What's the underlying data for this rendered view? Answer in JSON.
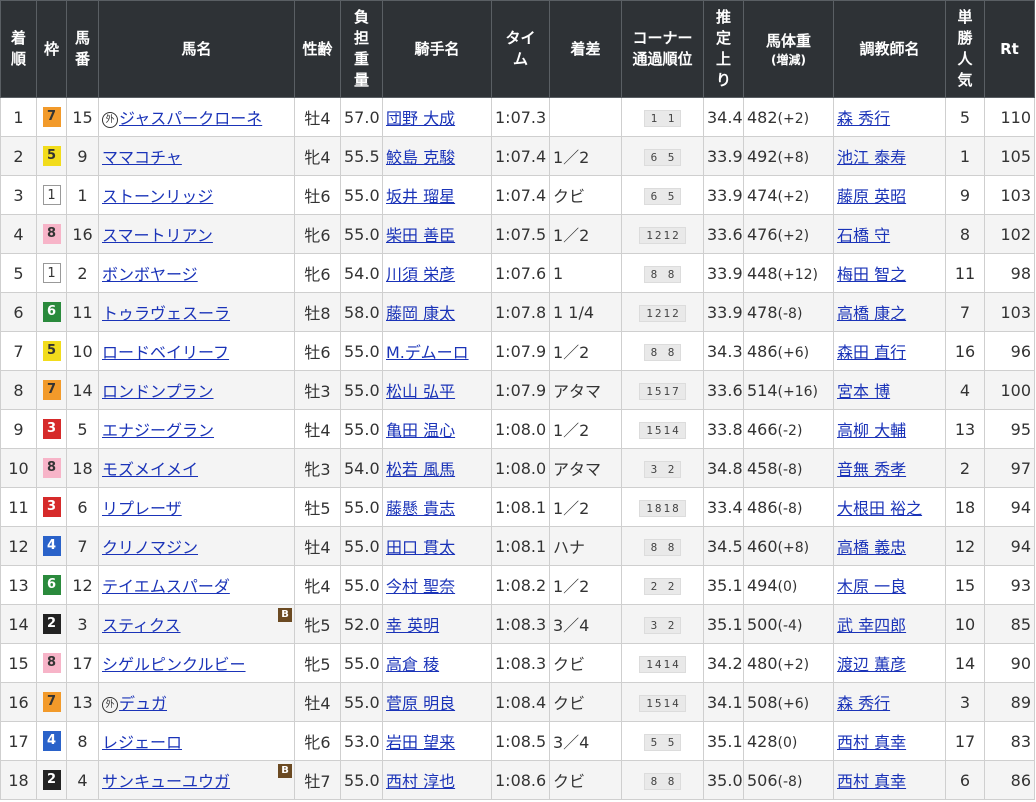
{
  "header": {
    "rank": [
      "着",
      "順"
    ],
    "waku": "枠",
    "num": [
      "馬",
      "番"
    ],
    "name": "馬名",
    "sex_age": "性齢",
    "weight": [
      "負",
      "担",
      "重",
      "量"
    ],
    "jockey": "騎手名",
    "time": [
      "タイ",
      "ム"
    ],
    "margin": "着差",
    "corner": [
      "コーナー",
      "通過順位"
    ],
    "last3f": [
      "推",
      "定",
      "上",
      "り"
    ],
    "body": "馬体重",
    "body_sub": "(増減)",
    "trainer": "調教師名",
    "popularity": [
      "単",
      "勝",
      "人",
      "気"
    ],
    "rt": "Rt"
  },
  "blinker_label": "B",
  "gaikoku_label": "外",
  "rows": [
    {
      "rank": "1",
      "waku": "7",
      "num": "15",
      "gaikoku": true,
      "name": "ジャスパークローネ",
      "blinker": false,
      "sex_age": "牡4",
      "weight": "57.0",
      "jockey": "団野 大成",
      "time": "1:07.3",
      "margin": "",
      "corner": "1 1",
      "last3f": "34.4",
      "body": "482",
      "body_chg": "(+2)",
      "trainer": "森 秀行",
      "pop": "5",
      "rt": "110"
    },
    {
      "rank": "2",
      "waku": "5",
      "num": "9",
      "gaikoku": false,
      "name": "ママコチャ",
      "blinker": false,
      "sex_age": "牝4",
      "weight": "55.5",
      "jockey": "鮫島 克駿",
      "time": "1:07.4",
      "margin": "1／2",
      "corner": "6 5",
      "last3f": "33.9",
      "body": "492",
      "body_chg": "(+8)",
      "trainer": "池江 泰寿",
      "pop": "1",
      "rt": "105"
    },
    {
      "rank": "3",
      "waku": "1",
      "num": "1",
      "gaikoku": false,
      "name": "ストーンリッジ",
      "blinker": false,
      "sex_age": "牡6",
      "weight": "55.0",
      "jockey": "坂井 瑠星",
      "time": "1:07.4",
      "margin": "クビ",
      "corner": "6 5",
      "last3f": "33.9",
      "body": "474",
      "body_chg": "(+2)",
      "trainer": "藤原 英昭",
      "pop": "9",
      "rt": "103"
    },
    {
      "rank": "4",
      "waku": "8",
      "num": "16",
      "gaikoku": false,
      "name": "スマートリアン",
      "blinker": false,
      "sex_age": "牝6",
      "weight": "55.0",
      "jockey": "柴田 善臣",
      "time": "1:07.5",
      "margin": "1／2",
      "corner": "1212",
      "last3f": "33.6",
      "body": "476",
      "body_chg": "(+2)",
      "trainer": "石橋 守",
      "pop": "8",
      "rt": "102"
    },
    {
      "rank": "5",
      "waku": "1",
      "num": "2",
      "gaikoku": false,
      "name": "ボンボヤージ",
      "blinker": false,
      "sex_age": "牝6",
      "weight": "54.0",
      "jockey": "川須 栄彦",
      "time": "1:07.6",
      "margin": "1",
      "corner": "8 8",
      "last3f": "33.9",
      "body": "448",
      "body_chg": "(+12)",
      "trainer": "梅田 智之",
      "pop": "11",
      "rt": "98"
    },
    {
      "rank": "6",
      "waku": "6",
      "num": "11",
      "gaikoku": false,
      "name": "トゥラヴェスーラ",
      "blinker": false,
      "sex_age": "牡8",
      "weight": "58.0",
      "jockey": "藤岡 康太",
      "time": "1:07.8",
      "margin": "1 1/4",
      "corner": "1212",
      "last3f": "33.9",
      "body": "478",
      "body_chg": "(-8)",
      "trainer": "高橋 康之",
      "pop": "7",
      "rt": "103"
    },
    {
      "rank": "7",
      "waku": "5",
      "num": "10",
      "gaikoku": false,
      "name": "ロードベイリーフ",
      "blinker": false,
      "sex_age": "牡6",
      "weight": "55.0",
      "jockey": "M.デムーロ",
      "time": "1:07.9",
      "margin": "1／2",
      "corner": "8 8",
      "last3f": "34.3",
      "body": "486",
      "body_chg": "(+6)",
      "trainer": "森田 直行",
      "pop": "16",
      "rt": "96"
    },
    {
      "rank": "8",
      "waku": "7",
      "num": "14",
      "gaikoku": false,
      "name": "ロンドンプラン",
      "blinker": false,
      "sex_age": "牡3",
      "weight": "55.0",
      "jockey": "松山 弘平",
      "time": "1:07.9",
      "margin": "アタマ",
      "corner": "1517",
      "last3f": "33.6",
      "body": "514",
      "body_chg": "(+16)",
      "trainer": "宮本 博",
      "pop": "4",
      "rt": "100"
    },
    {
      "rank": "9",
      "waku": "3",
      "num": "5",
      "gaikoku": false,
      "name": "エナジーグラン",
      "blinker": false,
      "sex_age": "牡4",
      "weight": "55.0",
      "jockey": "亀田 温心",
      "time": "1:08.0",
      "margin": "1／2",
      "corner": "1514",
      "last3f": "33.8",
      "body": "466",
      "body_chg": "(-2)",
      "trainer": "高柳 大輔",
      "pop": "13",
      "rt": "95"
    },
    {
      "rank": "10",
      "waku": "8",
      "num": "18",
      "gaikoku": false,
      "name": "モズメイメイ",
      "blinker": false,
      "sex_age": "牝3",
      "weight": "54.0",
      "jockey": "松若 風馬",
      "time": "1:08.0",
      "margin": "アタマ",
      "corner": "3 2",
      "last3f": "34.8",
      "body": "458",
      "body_chg": "(-8)",
      "trainer": "音無 秀孝",
      "pop": "2",
      "rt": "97"
    },
    {
      "rank": "11",
      "waku": "3",
      "num": "6",
      "gaikoku": false,
      "name": "リプレーザ",
      "blinker": false,
      "sex_age": "牡5",
      "weight": "55.0",
      "jockey": "藤懸 貴志",
      "time": "1:08.1",
      "margin": "1／2",
      "corner": "1818",
      "last3f": "33.4",
      "body": "486",
      "body_chg": "(-8)",
      "trainer": "大根田 裕之",
      "pop": "18",
      "rt": "94"
    },
    {
      "rank": "12",
      "waku": "4",
      "num": "7",
      "gaikoku": false,
      "name": "クリノマジン",
      "blinker": false,
      "sex_age": "牡4",
      "weight": "55.0",
      "jockey": "田口 貫太",
      "time": "1:08.1",
      "margin": "ハナ",
      "corner": "8 8",
      "last3f": "34.5",
      "body": "460",
      "body_chg": "(+8)",
      "trainer": "高橋 義忠",
      "pop": "12",
      "rt": "94"
    },
    {
      "rank": "13",
      "waku": "6",
      "num": "12",
      "gaikoku": false,
      "name": "テイエムスパーダ",
      "blinker": false,
      "sex_age": "牝4",
      "weight": "55.0",
      "jockey": "今村 聖奈",
      "time": "1:08.2",
      "margin": "1／2",
      "corner": "2 2",
      "last3f": "35.1",
      "body": "494",
      "body_chg": "(0)",
      "trainer": "木原 一良",
      "pop": "15",
      "rt": "93"
    },
    {
      "rank": "14",
      "waku": "2",
      "num": "3",
      "gaikoku": false,
      "name": "スティクス",
      "blinker": true,
      "sex_age": "牝5",
      "weight": "52.0",
      "jockey": "幸 英明",
      "time": "1:08.3",
      "margin": "3／4",
      "corner": "3 2",
      "last3f": "35.1",
      "body": "500",
      "body_chg": "(-4)",
      "trainer": "武 幸四郎",
      "pop": "10",
      "rt": "85"
    },
    {
      "rank": "15",
      "waku": "8",
      "num": "17",
      "gaikoku": false,
      "name": "シゲルピンクルビー",
      "blinker": false,
      "sex_age": "牝5",
      "weight": "55.0",
      "jockey": "高倉 稜",
      "time": "1:08.3",
      "margin": "クビ",
      "corner": "1414",
      "last3f": "34.2",
      "body": "480",
      "body_chg": "(+2)",
      "trainer": "渡辺 薫彦",
      "pop": "14",
      "rt": "90"
    },
    {
      "rank": "16",
      "waku": "7",
      "num": "13",
      "gaikoku": true,
      "name": "デュガ",
      "blinker": false,
      "sex_age": "牡4",
      "weight": "55.0",
      "jockey": "菅原 明良",
      "time": "1:08.4",
      "margin": "クビ",
      "corner": "1514",
      "last3f": "34.1",
      "body": "508",
      "body_chg": "(+6)",
      "trainer": "森 秀行",
      "pop": "3",
      "rt": "89"
    },
    {
      "rank": "17",
      "waku": "4",
      "num": "8",
      "gaikoku": false,
      "name": "レジェーロ",
      "blinker": false,
      "sex_age": "牝6",
      "weight": "53.0",
      "jockey": "岩田 望来",
      "time": "1:08.5",
      "margin": "3／4",
      "corner": "5 5",
      "last3f": "35.1",
      "body": "428",
      "body_chg": "(0)",
      "trainer": "西村 真幸",
      "pop": "17",
      "rt": "83"
    },
    {
      "rank": "18",
      "waku": "2",
      "num": "4",
      "gaikoku": false,
      "name": "サンキューユウガ",
      "blinker": true,
      "sex_age": "牡7",
      "weight": "55.0",
      "jockey": "西村 淳也",
      "time": "1:08.6",
      "margin": "クビ",
      "corner": "8 8",
      "last3f": "35.0",
      "body": "506",
      "body_chg": "(-8)",
      "trainer": "西村 真幸",
      "pop": "6",
      "rt": "86"
    }
  ]
}
